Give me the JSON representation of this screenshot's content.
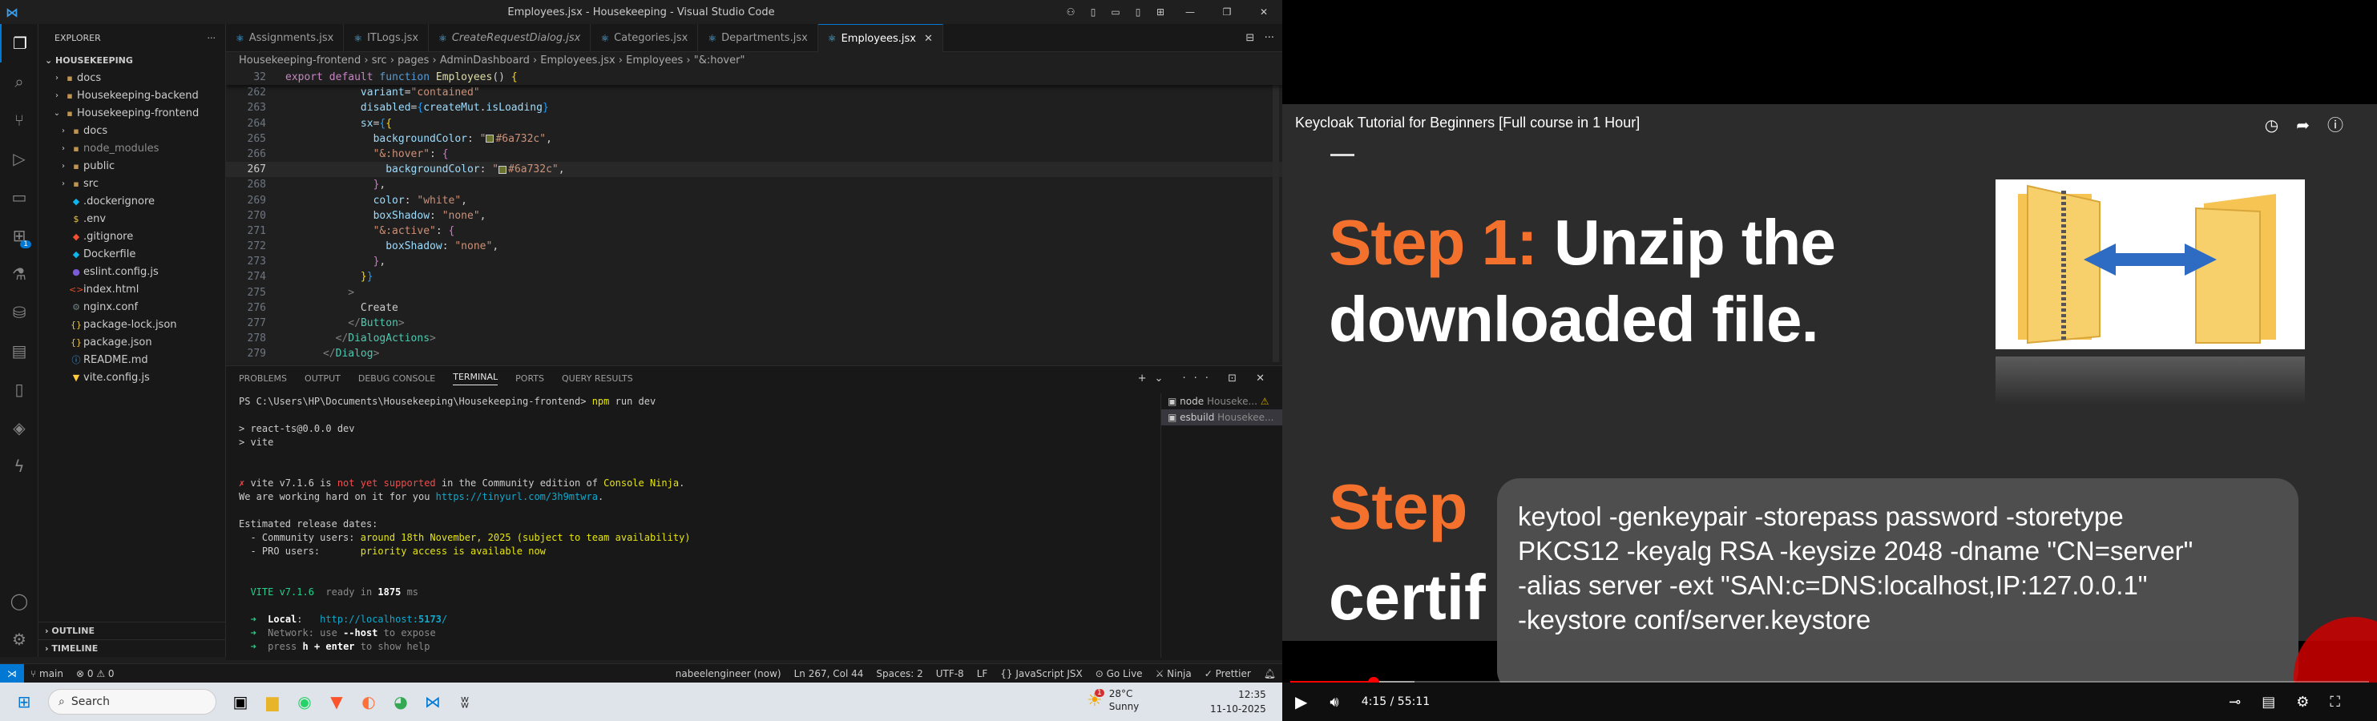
{
  "window_title": "Employees.jsx - Housekeeping - Visual Studio Code",
  "explorer": {
    "header": "EXPLORER",
    "project": "HOUSEKEEPING",
    "tree": [
      {
        "label": "docs",
        "type": "folder",
        "depth": 1,
        "open": false,
        "color": "#ccc"
      },
      {
        "label": "Housekeeping-backend",
        "type": "folder",
        "depth": 1,
        "open": false,
        "color": "#ccc"
      },
      {
        "label": "Housekeeping-frontend",
        "type": "folder",
        "depth": 1,
        "open": true,
        "color": "#ccc"
      },
      {
        "label": "docs",
        "type": "folder",
        "depth": 2,
        "open": false,
        "color": "#ccc"
      },
      {
        "label": "node_modules",
        "type": "folder",
        "depth": 2,
        "open": false,
        "color": "#8c8c8c"
      },
      {
        "label": "public",
        "type": "folder",
        "depth": 2,
        "open": false,
        "color": "#ccc"
      },
      {
        "label": "src",
        "type": "folder",
        "depth": 2,
        "open": false,
        "color": "#ccc"
      },
      {
        "label": ".dockerignore",
        "type": "file",
        "depth": 2,
        "icon": "◆",
        "icolor": "#0db7ed",
        "color": "#ccc"
      },
      {
        "label": ".env",
        "type": "file",
        "depth": 2,
        "icon": "$",
        "icolor": "#e8c84d",
        "color": "#ccc"
      },
      {
        "label": ".gitignore",
        "type": "file",
        "depth": 2,
        "icon": "◆",
        "icolor": "#f14e32",
        "color": "#ccc"
      },
      {
        "label": "Dockerfile",
        "type": "file",
        "depth": 2,
        "icon": "◆",
        "icolor": "#0db7ed",
        "color": "#ccc"
      },
      {
        "label": "eslint.config.js",
        "type": "file",
        "depth": 2,
        "icon": "●",
        "icolor": "#7b5cd6",
        "color": "#ccc"
      },
      {
        "label": "index.html",
        "type": "file",
        "depth": 2,
        "icon": "<>",
        "icolor": "#e44d26",
        "color": "#ccc"
      },
      {
        "label": "nginx.conf",
        "type": "file",
        "depth": 2,
        "icon": "⚙",
        "icolor": "#6d8086",
        "color": "#ccc"
      },
      {
        "label": "package-lock.json",
        "type": "file",
        "depth": 2,
        "icon": "{}",
        "icolor": "#e8c84d",
        "color": "#ccc"
      },
      {
        "label": "package.json",
        "type": "file",
        "depth": 2,
        "icon": "{}",
        "icolor": "#e8c84d",
        "color": "#ccc"
      },
      {
        "label": "README.md",
        "type": "file",
        "depth": 2,
        "icon": "ⓘ",
        "icolor": "#42a5f5",
        "color": "#ccc"
      },
      {
        "label": "vite.config.js",
        "type": "file",
        "depth": 2,
        "icon": "▼",
        "icolor": "#ffc83d",
        "color": "#ccc"
      }
    ],
    "outline": "OUTLINE",
    "timeline": "TIMELINE"
  },
  "tabs": [
    "Assignments.jsx",
    "ITLogs.jsx",
    "CreateRequestDialog.jsx",
    "Categories.jsx",
    "Departments.jsx",
    "Employees.jsx"
  ],
  "active_tab": "Employees.jsx",
  "breadcrumb": "Housekeeping-frontend  ›  src  ›  pages  ›  AdminDashboard  ›  Employees.jsx  ›  Employees  ›  \"&:hover\"",
  "sticky_line": {
    "num": "32",
    "text": "export default function Employees() {"
  },
  "code_lines": [
    {
      "num": "262",
      "html": "            <span class='prop'>variant</span>=<span class='str'>\"contained\"</span>"
    },
    {
      "num": "263",
      "html": "            <span class='prop'>disabled</span>=<span class='br3'>{</span><span class='prop'>createMut</span>.<span class='prop'>isLoading</span><span class='br3'>}</span>"
    },
    {
      "num": "264",
      "html": "            <span class='prop'>sx</span>=<span class='br3'>{</span><span class='br'>{</span>"
    },
    {
      "num": "265",
      "html": "              <span class='prop'>backgroundColor</span>: <span class='str'>\"<span class='swatch'></span>#6a732c\"</span>,"
    },
    {
      "num": "266",
      "html": "              <span class='str'>\"&amp;:hover\"</span>: <span class='br2'>{</span>"
    },
    {
      "num": "267",
      "html": "                <span class='prop'>backgroundColor</span>: <span class='str'>\"<span class='swatch'></span>#6a732c\"</span>,",
      "cur": true
    },
    {
      "num": "268",
      "html": "              <span class='br2'>}</span>,"
    },
    {
      "num": "269",
      "html": "              <span class='prop'>color</span>: <span class='str'>\"white\"</span>,"
    },
    {
      "num": "270",
      "html": "              <span class='prop'>boxShadow</span>: <span class='str'>\"none\"</span>,"
    },
    {
      "num": "271",
      "html": "              <span class='str'>\"&amp;:active\"</span>: <span class='br2'>{</span>"
    },
    {
      "num": "272",
      "html": "                <span class='prop'>boxShadow</span>: <span class='str'>\"none\"</span>,"
    },
    {
      "num": "273",
      "html": "              <span class='br2'>}</span>,"
    },
    {
      "num": "274",
      "html": "            <span class='br'>}</span><span class='br3'>}</span>"
    },
    {
      "num": "275",
      "html": "          <span class='tagb'>&gt;</span>"
    },
    {
      "num": "276",
      "html": "            Create"
    },
    {
      "num": "277",
      "html": "          <span class='tagb'>&lt;/</span><span class='tag'>Button</span><span class='tagb'>&gt;</span>"
    },
    {
      "num": "278",
      "html": "        <span class='tagb'>&lt;/</span><span class='tag'>DialogActions</span><span class='tagb'>&gt;</span>"
    },
    {
      "num": "279",
      "html": "      <span class='tagb'>&lt;/</span><span class='tag'>Dialog</span><span class='tagb'>&gt;</span>"
    }
  ],
  "panel_tabs": [
    "PROBLEMS",
    "OUTPUT",
    "DEBUG CONSOLE",
    "TERMINAL",
    "PORTS",
    "QUERY RESULTS"
  ],
  "active_panel": "TERMINAL",
  "terminal": [
    {
      "html": "PS C:\\Users\\HP\\Documents\\Housekeeping\\Housekeeping-frontend&gt; <span class='t-yel'>npm</span> run dev"
    },
    {
      "html": ""
    },
    {
      "html": "&gt; react-ts@0.0.0 dev"
    },
    {
      "html": "&gt; vite"
    },
    {
      "html": ""
    },
    {
      "html": ""
    },
    {
      "html": "<span class='t-red'>✗</span> vite v7.1.6 is <span class='t-red'>not yet supported</span> in the Community edition of <span class='t-yel'>Console Ninja</span>."
    },
    {
      "html": "We are working hard on it for you <span class='t-cyan'>https://tinyurl.com/3h9mtwra</span>."
    },
    {
      "html": ""
    },
    {
      "html": "Estimated release dates:"
    },
    {
      "html": "  - Community users: <span class='t-yel'>around 18th November, 2025</span> <span class='t-yel'>(subject to team availability)</span>"
    },
    {
      "html": "  - PRO users:       <span class='t-yel'>priority access is available now</span>"
    },
    {
      "html": ""
    },
    {
      "html": ""
    },
    {
      "html": "  <span class='t-grn'>VITE v7.1.6</span>  <span class='t-dim'>ready in</span> <span class='t-bold'>1875</span> <span class='t-dim'>ms</span>"
    },
    {
      "html": ""
    },
    {
      "html": "  <span class='t-grn'>➜</span>  <span class='t-bold'>Local</span>:   <span class='t-cyan'>http://localhost:<b>5173</b>/</span>"
    },
    {
      "html": "  <span class='t-grn'>➜</span>  <span class='t-dim'>Network: use </span><span class='t-bold'>--host</span><span class='t-dim'> to expose</span>"
    },
    {
      "html": "  <span class='t-grn'>➜</span>  <span class='t-dim'>press </span><span class='t-bold'>h + enter</span><span class='t-dim'> to show help</span>"
    },
    {
      "html": ""
    }
  ],
  "terminal_list": [
    {
      "name": "node",
      "path": "Houseke...",
      "warn": true
    },
    {
      "name": "esbuild",
      "path": "Housekee...",
      "warn": false
    }
  ],
  "status": {
    "branch": "main",
    "problems": "⊗ 0 ⚠ 0",
    "user": "nabeelengineer (now)",
    "position": "Ln 267, Col 44",
    "spaces": "Spaces: 2",
    "encoding": "UTF-8",
    "eol": "LF",
    "language": "{} JavaScript JSX",
    "golive": "Go Live",
    "ninja": "Ninja",
    "prettier": "✓ Prettier"
  },
  "video": {
    "title": "Keycloak Tutorial for Beginners [Full course in 1 Hour]",
    "step1_label": "Step 1:",
    "step1_text": " Unzip the",
    "step1_line2": "downloaded file.",
    "step2_label": "Step",
    "step2_text": "certif",
    "command_lines": [
      "keytool -genkeypair -storepass password -storetype",
      "PKCS12 -keyalg RSA -keysize 2048 -dname \"CN=server\"",
      "-alias server -ext \"SAN:c=DNS:localhost,IP:127.0.0.1\"",
      "-keystore conf/server.keystore"
    ],
    "time": "4:15 / 55:11",
    "progress": 0.077,
    "buffered": 0.115
  },
  "taskbar": {
    "search_placeholder": "Search",
    "weather_temp": "28°C",
    "weather_desc": "Sunny",
    "weather_badge": "1",
    "time": "12:35",
    "date": "11-10-2025"
  }
}
